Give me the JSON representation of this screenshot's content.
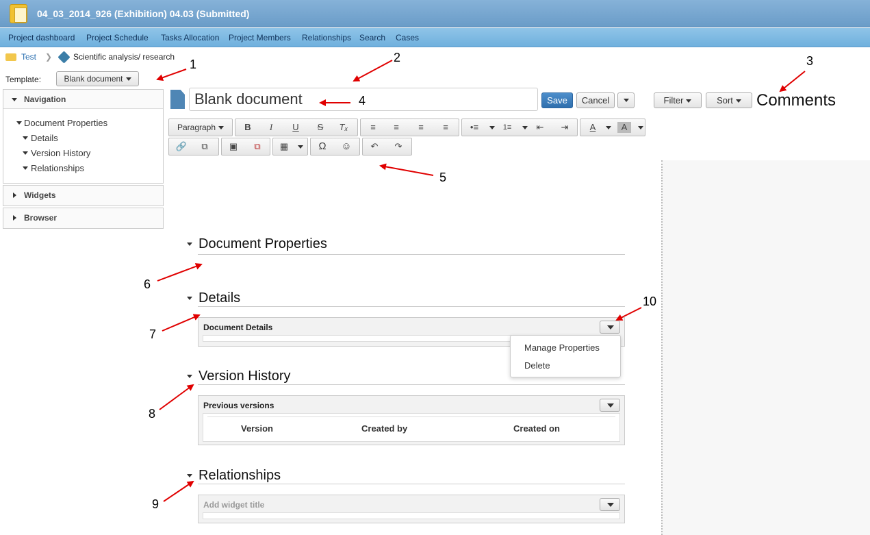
{
  "window": {
    "title": "04_03_2014_926 (Exhibition) 04.03 (Submitted)"
  },
  "menu": [
    "Project dashboard",
    "Project Schedule",
    "Tasks Allocation",
    "Project Members",
    "Relationships",
    "Search",
    "Cases"
  ],
  "breadcrumb": {
    "root": "Test",
    "current": "Scientific analysis/ research"
  },
  "template": {
    "label": "Template:",
    "value": "Blank document"
  },
  "sidebar": {
    "navigation": "Navigation",
    "nav_items": [
      "Document Properties",
      "Details",
      "Version History",
      "Relationships"
    ],
    "widgets": "Widgets",
    "browser": "Browser"
  },
  "editor": {
    "title_value": "Blank document",
    "save": "Save",
    "cancel": "Cancel",
    "filter": "Filter",
    "sort": "Sort",
    "comments": "Comments",
    "paragraph": "Paragraph"
  },
  "sections": {
    "doc_props": "Document Properties",
    "details": "Details",
    "version_history": "Version History",
    "relationships": "Relationships"
  },
  "widgets": {
    "document_details": "Document Details",
    "previous_versions": "Previous versions",
    "add_widget_title": "Add widget title",
    "columns": [
      "Version",
      "Created by",
      "Created on"
    ]
  },
  "dropdown": [
    "Manage Properties",
    "Delete"
  ],
  "annotations": [
    "1",
    "2",
    "3",
    "4",
    "5",
    "6",
    "7",
    "8",
    "9",
    "10"
  ],
  "colors": {
    "titlebar": "#6a9cc8",
    "menubar": "#6fb0dd",
    "primary": "#2f6fad",
    "annotation": "#e00000"
  }
}
